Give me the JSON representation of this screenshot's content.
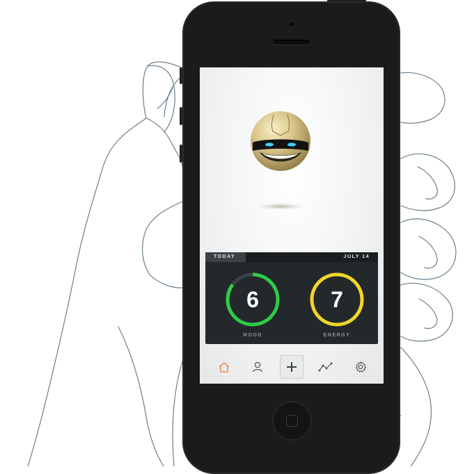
{
  "app": {
    "card": {
      "today_label": "TODAY",
      "date_label": "JULY 14"
    },
    "metrics": [
      {
        "label": "MOOD",
        "value": "6",
        "level": 0.85,
        "color": "#2ecc48"
      },
      {
        "label": "ENERGY",
        "value": "7",
        "level": 1.0,
        "color": "#f1d52a"
      }
    ],
    "tabbar": {
      "items": [
        {
          "icon": "home-icon",
          "active": true
        },
        {
          "icon": "profile-icon",
          "active": false
        },
        {
          "icon": "plus-icon",
          "active": false
        },
        {
          "icon": "chart-line-icon",
          "active": false
        },
        {
          "icon": "gear-icon",
          "active": false
        }
      ],
      "active_color": "#f07a3a"
    }
  }
}
